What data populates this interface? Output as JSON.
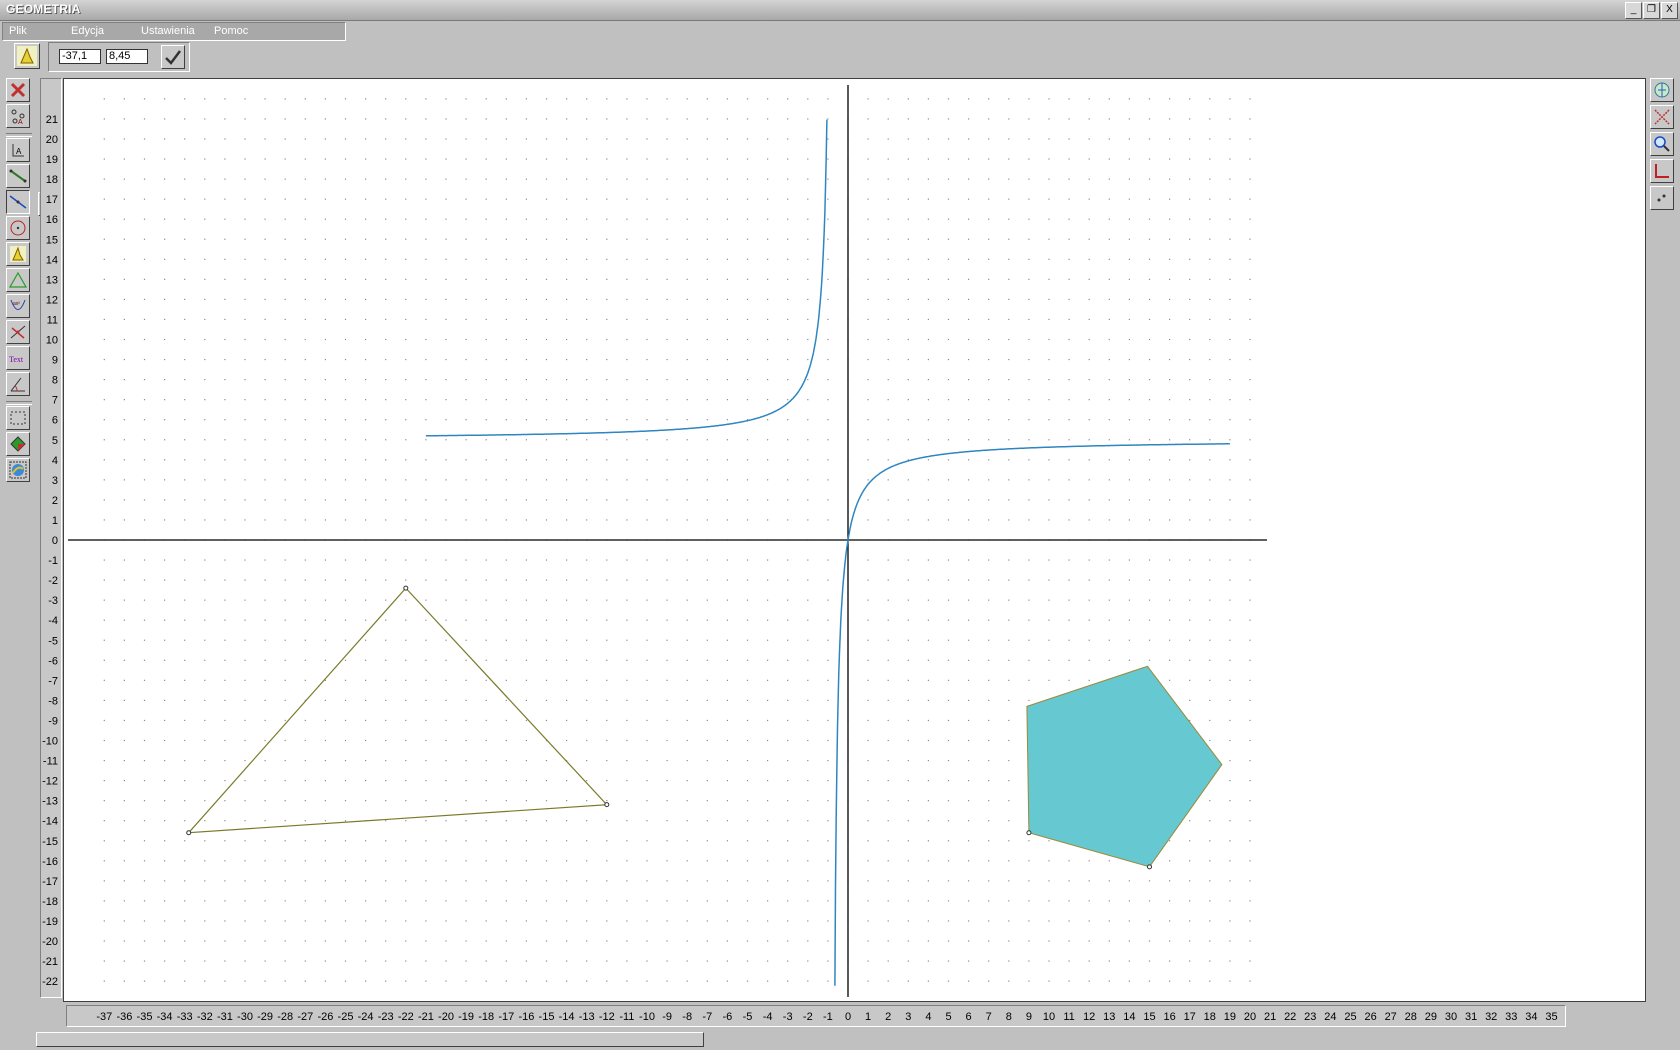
{
  "app": {
    "title": "GEOMETRIA",
    "window_buttons": [
      "_",
      "❐",
      "X"
    ]
  },
  "menu": {
    "items": [
      "Plik",
      "Edycja",
      "Ustawienia",
      "Pomoc"
    ]
  },
  "coords": {
    "x_value": "-37,1",
    "y_value": "8,45"
  },
  "toolbar": {
    "left_tools": [
      "delete-icon",
      "points-icon",
      "label-point-icon",
      "segment-icon",
      "line-icon",
      "circle-icon",
      "point-tool-icon",
      "triangle-icon",
      "function-icon",
      "intersection-icon",
      "text-icon",
      "angle-icon",
      "select-rect-icon",
      "fill-icon",
      "color-palette-icon"
    ],
    "text_tool_label": "Text",
    "line_submenu": [
      "line-basic-icon",
      "line-perpendicular-icon",
      "line-intersect-icon",
      "line-parallel-icon",
      "line-formula-icon"
    ],
    "right_tools": [
      "axes-toggle-icon",
      "grid-x-icon",
      "zoom-icon",
      "axes-origin-icon",
      "scale-icon"
    ]
  },
  "axes": {
    "x_ticks": [
      "-37",
      "-36",
      "-35",
      "-34",
      "-33",
      "-32",
      "-31",
      "-30",
      "-29",
      "-28",
      "-27",
      "-26",
      "-25",
      "-24",
      "-23",
      "-22",
      "-21",
      "-20",
      "-19",
      "-18",
      "-17",
      "-16",
      "-15",
      "-14",
      "-13",
      "-12",
      "-11",
      "-10",
      "-9",
      "-8",
      "-7",
      "-6",
      "-5",
      "-4",
      "-3",
      "-2",
      "-1",
      "0",
      "1",
      "2",
      "3",
      "4",
      "5",
      "6",
      "7",
      "8",
      "9",
      "10",
      "11",
      "12",
      "13",
      "14",
      "15",
      "16",
      "17",
      "18",
      "19",
      "20",
      "21",
      "22",
      "23",
      "24",
      "25",
      "26",
      "27",
      "28",
      "29",
      "30",
      "31",
      "32",
      "33",
      "34",
      "35",
      "3"
    ],
    "y_ticks": [
      "21",
      "20",
      "19",
      "18",
      "17",
      "16",
      "15",
      "14",
      "13",
      "12",
      "11",
      "10",
      "9",
      "8",
      "7",
      "6",
      "5",
      "4",
      "3",
      "2",
      "1",
      "0",
      "-1",
      "-2",
      "-3",
      "-4",
      "-5",
      "-6",
      "-7",
      "-8",
      "-9",
      "-10",
      "-11",
      "-12",
      "-13",
      "-14",
      "-15",
      "-16",
      "-17",
      "-18",
      "-19",
      "-20",
      "-21",
      "-22"
    ],
    "x_range": [
      -37.5,
      35.5
    ],
    "y_range": [
      -22.5,
      22
    ]
  },
  "shapes": {
    "function_curve": {
      "formula": "y = 5 - 4/(x+0.8)",
      "color": "#2e86c1",
      "x_range": [
        -21,
        19
      ]
    },
    "triangle": {
      "vertices": [
        [
          -22,
          -2.4
        ],
        [
          -12,
          -13.2
        ],
        [
          -32.8,
          -14.6
        ]
      ],
      "stroke": "#7a7a2a"
    },
    "pentagon": {
      "vertices": [
        [
          14.9,
          -6.3
        ],
        [
          18.6,
          -11.2
        ],
        [
          15,
          -16.3
        ],
        [
          9,
          -14.6
        ],
        [
          8.9,
          -8.3
        ]
      ],
      "fill": "#66c8d0",
      "stroke": "#9a8a3a"
    }
  },
  "colors": {
    "background": "#c0c0c0",
    "canvas": "#ffffff",
    "grid_dot": "#8a8a8a",
    "axis": "#000000"
  }
}
